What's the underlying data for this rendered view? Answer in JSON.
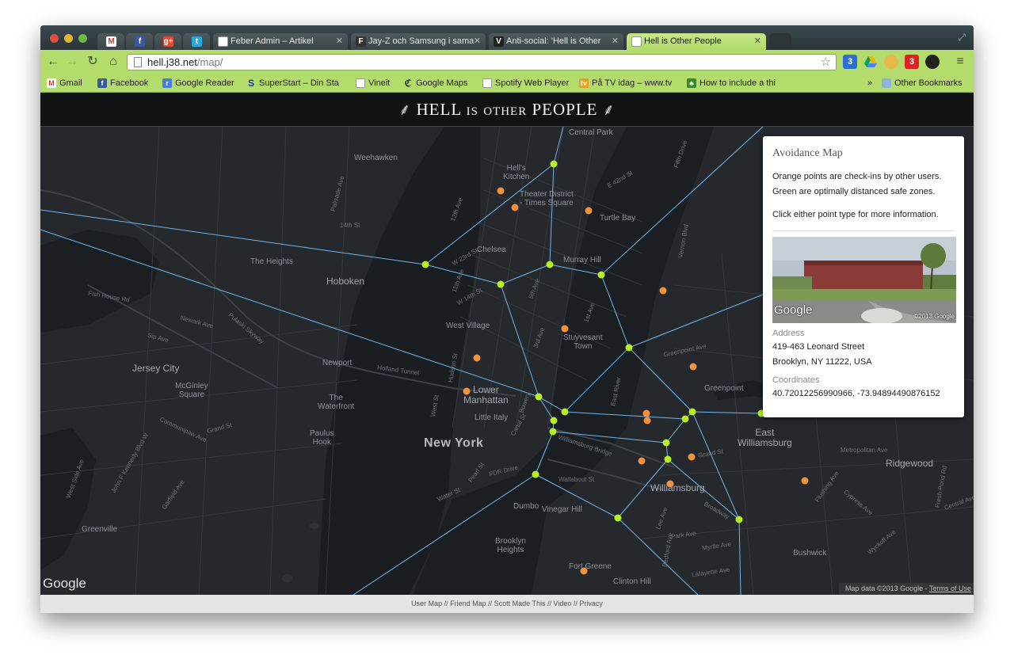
{
  "browser": {
    "tabs": [
      {
        "title": "",
        "icon": "gmail-icon"
      },
      {
        "title": "",
        "icon": "facebook-icon"
      },
      {
        "title": "",
        "icon": "google-plus-icon"
      },
      {
        "title": "",
        "icon": "twitter-icon"
      },
      {
        "title": "Feber Admin – Artikel",
        "icon": "page-icon"
      },
      {
        "title": "Jay-Z och Samsung i sama",
        "icon": "feber-icon"
      },
      {
        "title": "Anti-social: 'Hell is Other",
        "icon": "verge-icon"
      },
      {
        "title": "Hell is Other People",
        "icon": "page-icon"
      }
    ],
    "url_host": "hell.j38.net",
    "url_path": "/map/",
    "extensions": [
      {
        "label": "3",
        "color": "#2a6fd1",
        "icon": "calendar-icon"
      },
      {
        "label": "",
        "color": "#2aa34a",
        "icon": "drive-icon"
      },
      {
        "label": "",
        "color": "#e8b84a",
        "icon": "face-icon"
      },
      {
        "label": "3",
        "color": "#d22",
        "icon": "mail-checker-icon"
      },
      {
        "label": "",
        "color": "#222",
        "icon": "ghost-icon"
      }
    ],
    "bookmarks": [
      {
        "label": "Gmail",
        "icon": "gmail-icon"
      },
      {
        "label": "Facebook",
        "icon": "facebook-icon"
      },
      {
        "label": "Google Reader",
        "icon": "rss-icon"
      },
      {
        "label": "SuperStart – Din Sta",
        "icon": "superstart-icon"
      },
      {
        "label": "Vineit",
        "icon": "page-icon"
      },
      {
        "label": "Google Maps",
        "icon": "maps-icon"
      },
      {
        "label": "Spotify Web Player",
        "icon": "page-icon"
      },
      {
        "label": "På TV idag – www.tv",
        "icon": "tv-icon"
      },
      {
        "label": "How to include a thi",
        "icon": "tree-icon"
      }
    ],
    "bookmarks_more": "»",
    "other_bookmarks": "Other Bookmarks"
  },
  "site": {
    "title_main1": "HELL",
    "title_small1": "IS",
    "title_small2": "OTHER",
    "title_main2": "PEOPLE"
  },
  "map": {
    "labels": {
      "hoboken": "Hoboken",
      "jersey_city": "Jersey City",
      "new_york": "New York",
      "lower_manhattan": "Lower\nManhattan",
      "west_village": "West Village",
      "chelsea": "Chelsea",
      "murray_hill": "Murray Hill",
      "turtle_bay": "Turtle Bay",
      "stuyvesant_town": "Stuyvesant\nTown",
      "greenpoint": "Greenpoint",
      "williamsburg": "Williamsburg",
      "east_williamsburg": "East\nWilliamsburg",
      "ridgewood": "Ridgewood",
      "bushwick": "Bushwick",
      "dumbo": "Dumbo",
      "vinegar_hill": "Vinegar Hill",
      "brooklyn_heights": "Brooklyn\nHeights",
      "fort_greene": "Fort Greene",
      "clinton_hill": "Clinton Hill",
      "the_heights": "The Heights",
      "weehawken": "Weehawken",
      "newport": "Newport",
      "the_waterfront": "The\nWaterfront",
      "paulus_hook": "Paulus\nHook",
      "mcginley_square": "McGinley\nSquare",
      "greenville": "Greenville",
      "hells_kitchen": "Hell's\nKitchen",
      "theater_district": "Theater District\n- Times Square",
      "central_park": "Central Park",
      "little_italy": "Little Italy",
      "holland_tunnel": "Holland Tunnel",
      "fdr_drive": "FDR Drive",
      "williamsburg_bridge": "Williamsburg Bridge",
      "east_river": "East River",
      "greenpoint_ave": "Greenpoint Ave",
      "metropolitan_ave": "Metropolitan Ave",
      "grand_st": "Grand St",
      "broadway": "Broadway",
      "park_ave": "Park Ave",
      "myrtle_ave": "Myrtle Ave",
      "lafayette_ave": "Lafayette Ave",
      "grand_st_jc": "Grand St",
      "communipaw_ave": "Communipaw Ave",
      "fish_house_rd": "Fish House Rd",
      "newark_ave": "Newark Ave",
      "pulaski_skyway": "Pulaski Skyway",
      "sip_ave": "Sip Ave",
      "west_side_ave": "West Side Ave",
      "garfield_ave": "Garfield Ave",
      "john_f_kennedy_blvd": "John F Kennedy Blvd W",
      "14th_st": "14th St",
      "w_14th_st": "W 14th St",
      "w_23rd_st": "W 23rd St",
      "11th_ave": "11th Ave",
      "12th_ave": "12th Ave",
      "5th_ave": "5th Ave",
      "3rd_ave": "3rd Ave",
      "1st_ave": "1st Ave",
      "e_42nd_st": "E 42nd St",
      "fifth_drive": "Fifth Drive",
      "vernon_blvd": "Vernon Blvd",
      "hudson_st": "Hudson St",
      "west_st": "West St",
      "canal_st": "Canal St",
      "bowery": "Bowery",
      "water_st": "Water St",
      "pearl_st": "Pearl St",
      "flushing_ave": "Flushing Ave",
      "cypress_ave": "Cypress Ave",
      "wyckoff_ave": "Wyckoff Ave",
      "central_ave": "Central Ave",
      "fresh_pond_rd": "Fresh Pond Rd",
      "lee_ave": "Lee Ave",
      "bedford_ave": "Bedford Ave",
      "wallabout": "Wallabout St",
      "palisade_ave": "Palisade Ave"
    },
    "google_logo": "Google",
    "attribution": "Map data ©2013 Google - ",
    "terms": "Terms of Use"
  },
  "panel": {
    "title": "Avoidance Map",
    "line1": "Orange points are check-ins by other users.",
    "line2": "Green are optimally distanced safe zones.",
    "line3": "Click either point type for more information.",
    "streetview_logo": "Google",
    "streetview_copy": "©2013 Google",
    "address_label": "Address",
    "address_line1": "419-463 Leonard Street",
    "address_line2": "Brooklyn, NY 11222, USA",
    "coords_label": "Coordinates",
    "coords_value": "40.72012256990966, -73.94894490876152"
  },
  "footer": {
    "links": [
      "User Map",
      "Friend Map",
      "Scott Made This",
      "Video",
      "Privacy"
    ],
    "separator": " // "
  },
  "colors": {
    "orange_point": "#f2923a",
    "green_point": "#b8ef22",
    "voronoi_line": "#7ec4ff",
    "chrome_green": "#b4dc6c"
  }
}
